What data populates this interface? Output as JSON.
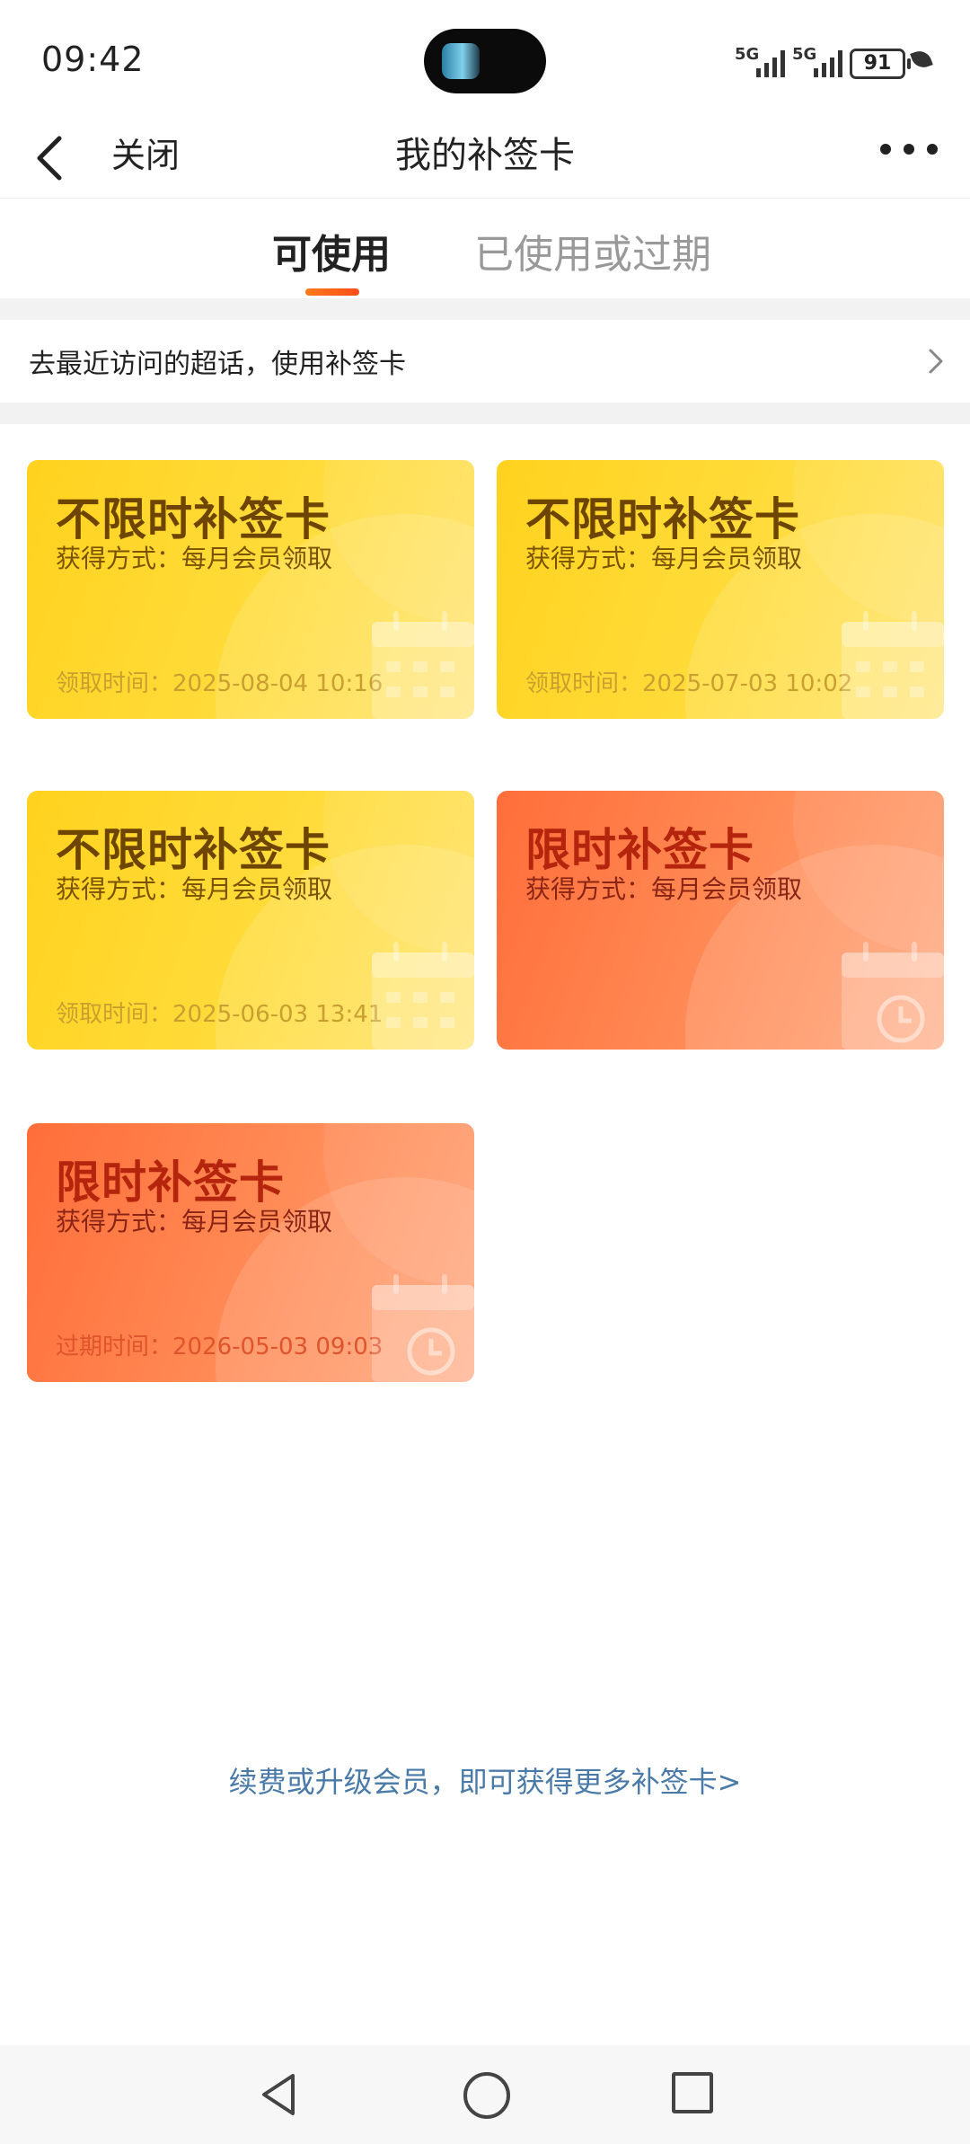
{
  "status": {
    "time": "09:42",
    "network1": "5G",
    "network2": "5G",
    "battery": "91"
  },
  "nav": {
    "close_label": "关闭",
    "title": "我的补签卡"
  },
  "tabs": [
    {
      "label": "可使用",
      "active": true
    },
    {
      "label": "已使用或过期",
      "active": false
    }
  ],
  "notice": {
    "text": "去最近访问的超话，使用补签卡"
  },
  "cards": [
    {
      "title": "不限时补签卡",
      "source": "获得方式：每月会员领取",
      "time": "领取时间：2025-08-04 10:16",
      "style": "yellow"
    },
    {
      "title": "不限时补签卡",
      "source": "获得方式：每月会员领取",
      "time": "领取时间：2025-07-03 10:02",
      "style": "yellow"
    },
    {
      "title": "不限时补签卡",
      "source": "获得方式：每月会员领取",
      "time": "领取时间：2025-06-03 13:41",
      "style": "yellow"
    },
    {
      "title": "限时补签卡",
      "source": "获得方式：每月会员领取",
      "time": "",
      "style": "orange"
    },
    {
      "title": "限时补签卡",
      "source": "获得方式：每月会员领取",
      "time": "过期时间：2026-05-03 09:03",
      "style": "orange"
    }
  ],
  "footer": {
    "link": "续费或升级会员，即可获得更多补签卡>"
  },
  "colors": {
    "accent": "#ff5a1f",
    "link": "#4a7aa8",
    "card_yellow": "#ffd21e",
    "card_orange": "#ff6e3a"
  },
  "icons": [
    "back-icon",
    "more-icon",
    "chevron-right-icon",
    "calendar-icon",
    "clock-icon",
    "nav-back-icon",
    "nav-home-icon",
    "nav-recent-icon"
  ]
}
